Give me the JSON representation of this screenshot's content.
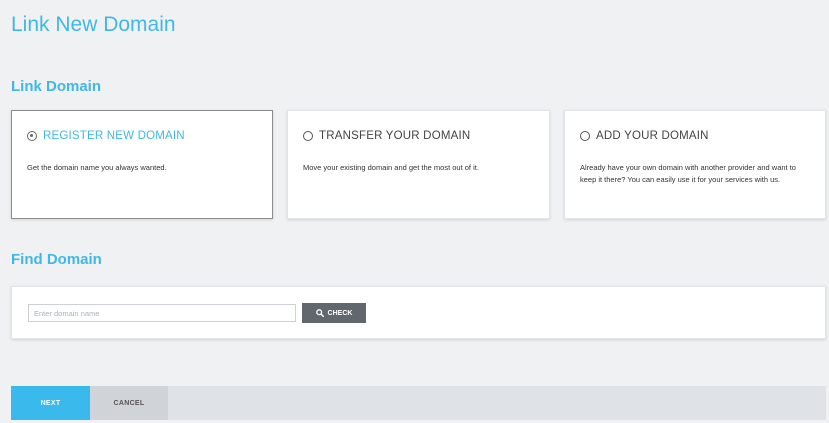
{
  "page": {
    "title": "Link New Domain"
  },
  "link_domain": {
    "section_title": "Link Domain",
    "options": [
      {
        "label": "REGISTER NEW DOMAIN",
        "description": "Get the domain name you always wanted.",
        "selected": true
      },
      {
        "label": "TRANSFER YOUR DOMAIN",
        "description": "Move your existing domain and get the most out of it.",
        "selected": false
      },
      {
        "label": "ADD YOUR DOMAIN",
        "description": "Already have your own domain with another provider and want to keep it there? You can easily use it for your services with us.",
        "selected": false
      }
    ]
  },
  "find_domain": {
    "section_title": "Find Domain",
    "input_placeholder": "Enter domain name",
    "input_value": "",
    "check_label": "CHECK",
    "check_icon": "search-icon"
  },
  "footer": {
    "next_label": "NEXT",
    "cancel_label": "CANCEL"
  },
  "colors": {
    "accent": "#3fb8e8",
    "primary_button": "#39b9ec",
    "check_button": "#62676d",
    "background": "#f0f1f3"
  }
}
